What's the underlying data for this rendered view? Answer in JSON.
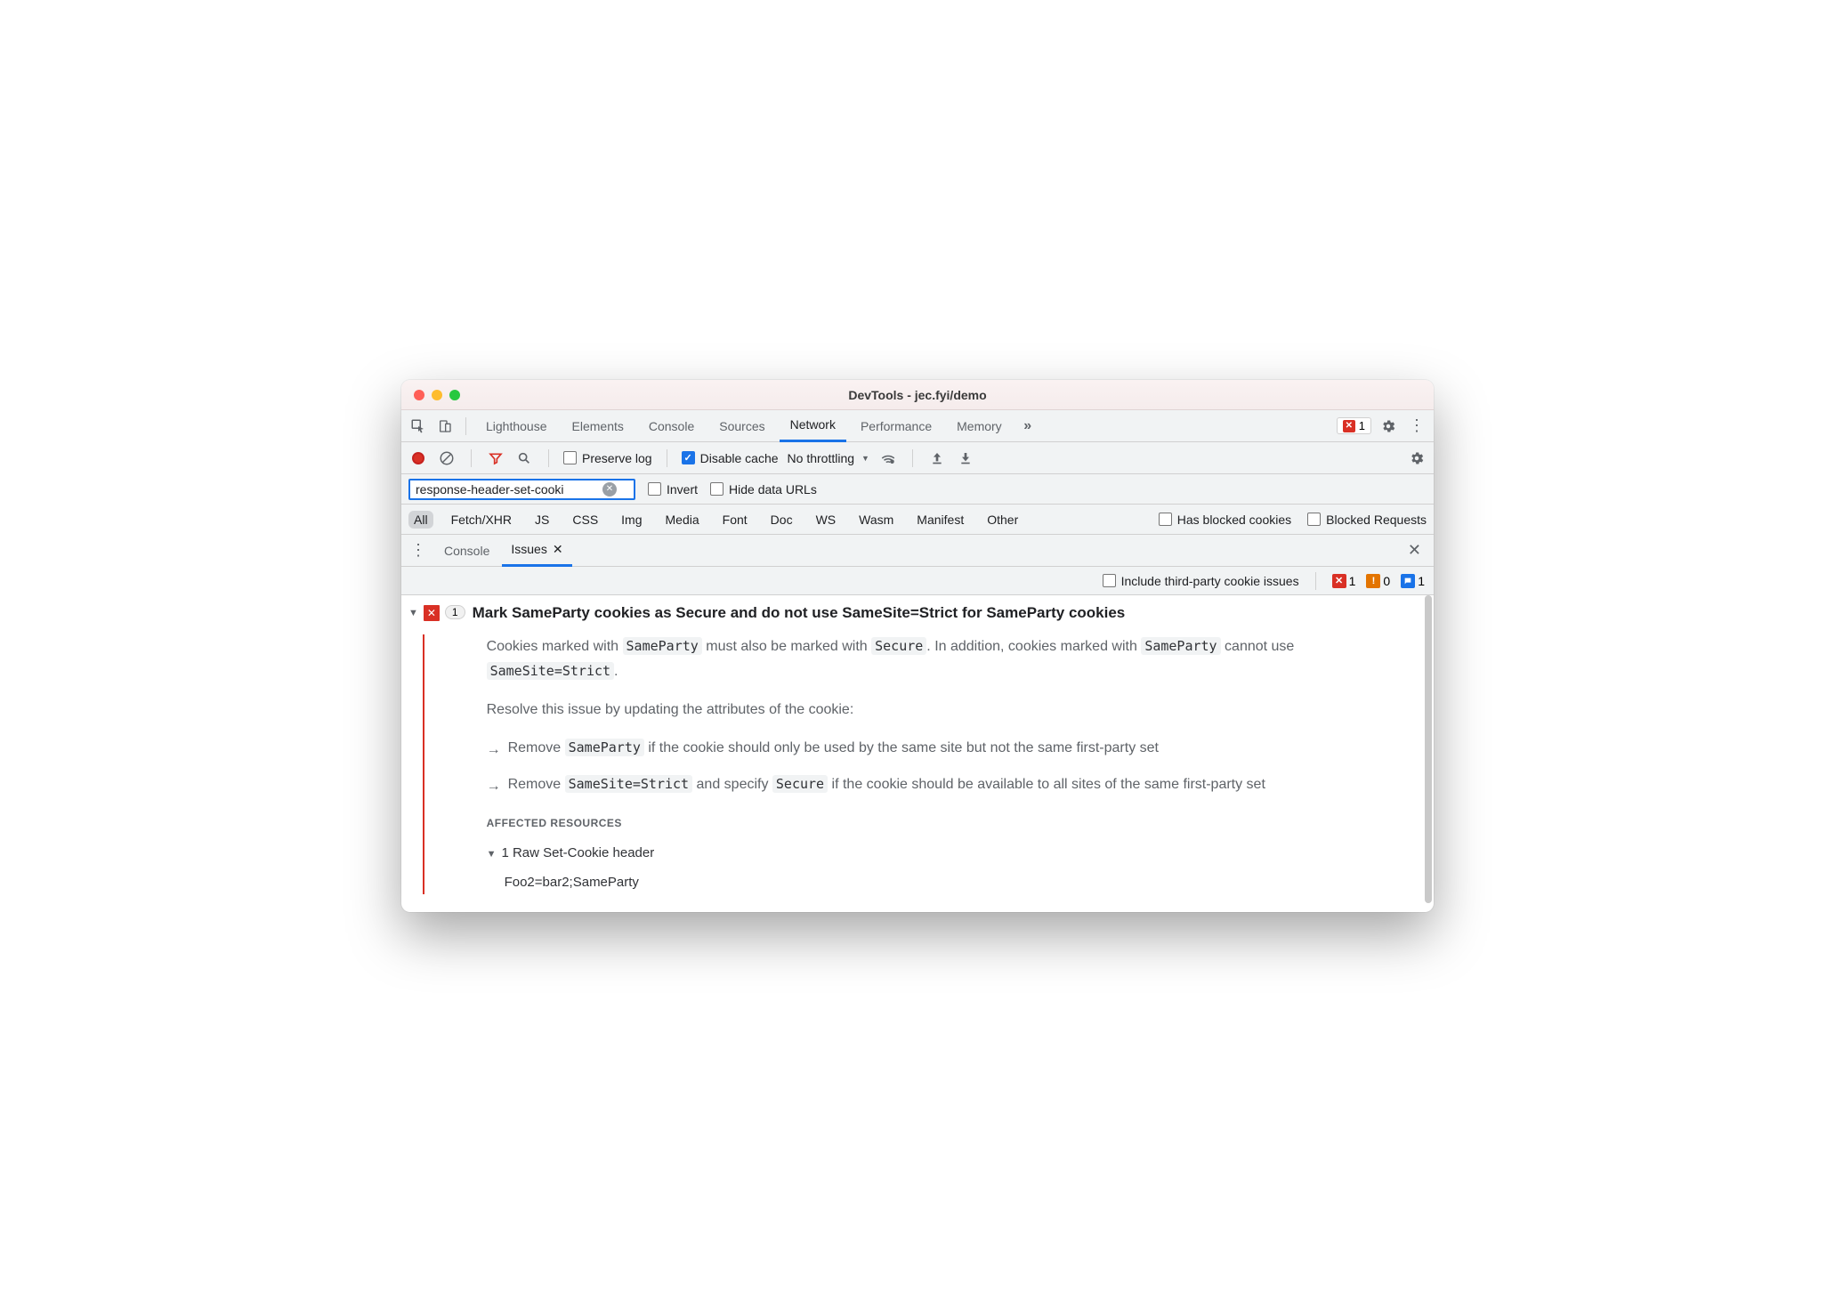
{
  "window": {
    "title": "DevTools - jec.fyi/demo"
  },
  "tabs": {
    "items": [
      "Lighthouse",
      "Elements",
      "Console",
      "Sources",
      "Network",
      "Performance",
      "Memory"
    ],
    "active": "Network",
    "error_count": "1"
  },
  "network_toolbar": {
    "preserve_log": "Preserve log",
    "disable_cache": "Disable cache",
    "throttling": "No throttling"
  },
  "filter": {
    "value": "response-header-set-cooki",
    "invert": "Invert",
    "hide_data_urls": "Hide data URLs"
  },
  "types": {
    "items": [
      "All",
      "Fetch/XHR",
      "JS",
      "CSS",
      "Img",
      "Media",
      "Font",
      "Doc",
      "WS",
      "Wasm",
      "Manifest",
      "Other"
    ],
    "has_blocked": "Has blocked cookies",
    "blocked_requests": "Blocked Requests"
  },
  "drawer": {
    "console": "Console",
    "issues": "Issues"
  },
  "issues_bar": {
    "include_third_party": "Include third-party cookie issues",
    "red": "1",
    "orange": "0",
    "blue": "1"
  },
  "issue": {
    "count": "1",
    "title": "Mark SameParty cookies as Secure and do not use SameSite=Strict for SameParty cookies",
    "p1_a": "Cookies marked with ",
    "p1_code1": "SameParty",
    "p1_b": " must also be marked with ",
    "p1_code2": "Secure",
    "p1_c": ". In addition, cookies marked with ",
    "p1_code3": "SameParty",
    "p1_d": " cannot use ",
    "p1_code4": "SameSite=Strict",
    "p1_e": ".",
    "p2": "Resolve this issue by updating the attributes of the cookie:",
    "b1_a": "Remove ",
    "b1_code": "SameParty",
    "b1_b": " if the cookie should only be used by the same site but not the same first-party set",
    "b2_a": "Remove ",
    "b2_code1": "SameSite=Strict",
    "b2_b": " and specify ",
    "b2_code2": "Secure",
    "b2_c": " if the cookie should be available to all sites of the same first-party set",
    "affected_label": "AFFECTED RESOURCES",
    "resource_header": "1 Raw Set-Cookie header",
    "resource_value": "Foo2=bar2;SameParty"
  }
}
